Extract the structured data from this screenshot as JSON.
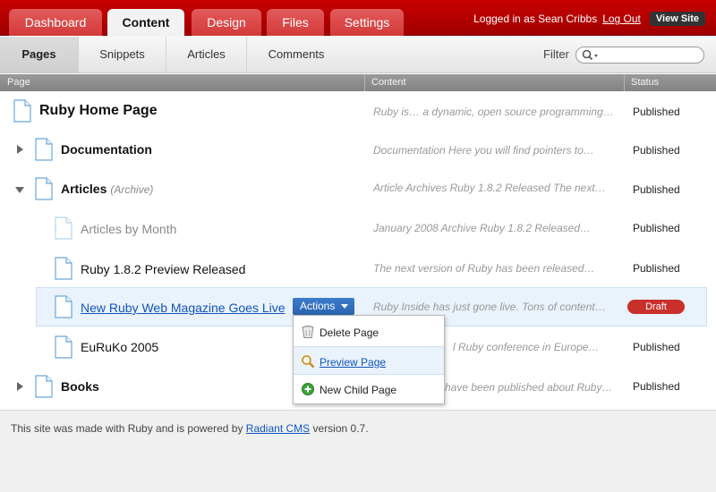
{
  "tabs": [
    {
      "label": "Dashboard"
    },
    {
      "label": "Content"
    },
    {
      "label": "Design"
    },
    {
      "label": "Files"
    },
    {
      "label": "Settings"
    }
  ],
  "user": {
    "logged_in_text": "Logged in as Sean Cribbs",
    "logout": "Log Out",
    "view_site": "View Site"
  },
  "subtabs": [
    {
      "label": "Pages"
    },
    {
      "label": "Snippets"
    },
    {
      "label": "Articles"
    },
    {
      "label": "Comments"
    }
  ],
  "filter": {
    "label": "Filter",
    "value": ""
  },
  "columns": {
    "page": "Page",
    "content": "Content",
    "status": "Status"
  },
  "rows": [
    {
      "title": "Ruby Home Page",
      "content": "Ruby is… a dynamic, open source programming…",
      "status": "Published"
    },
    {
      "title": "Documentation",
      "content": "Documentation  Here you will find pointers to…",
      "status": "Published"
    },
    {
      "title": "Articles",
      "note": "(Archive)",
      "content": "Article Archives  Ruby 1.8.2 Released  The next…",
      "status": "Published"
    },
    {
      "title": "Articles by Month",
      "content": "January 2008 Archive  Ruby 1.8.2 Released…",
      "status": "Published"
    },
    {
      "title": "Ruby 1.8.2 Preview Released",
      "content": "The next version of Ruby has been released…",
      "status": "Published"
    },
    {
      "title": "New Ruby Web Magazine Goes Live",
      "content": "Ruby Inside has just gone live. Tons of content…",
      "status": "Draft"
    },
    {
      "title": "EuRuKo 2005",
      "content": "l Ruby conference in Europe…",
      "status": "Published"
    },
    {
      "title": "Books",
      "content": "have been published about Ruby…",
      "status": "Published"
    }
  ],
  "actions": {
    "label": "Actions",
    "items": [
      {
        "label": "Delete Page"
      },
      {
        "label": "Preview Page"
      },
      {
        "label": "New Child Page"
      }
    ]
  },
  "footer": {
    "prefix": "This site was made with Ruby and is powered by",
    "link": "Radiant CMS",
    "suffix": "version 0.7."
  }
}
